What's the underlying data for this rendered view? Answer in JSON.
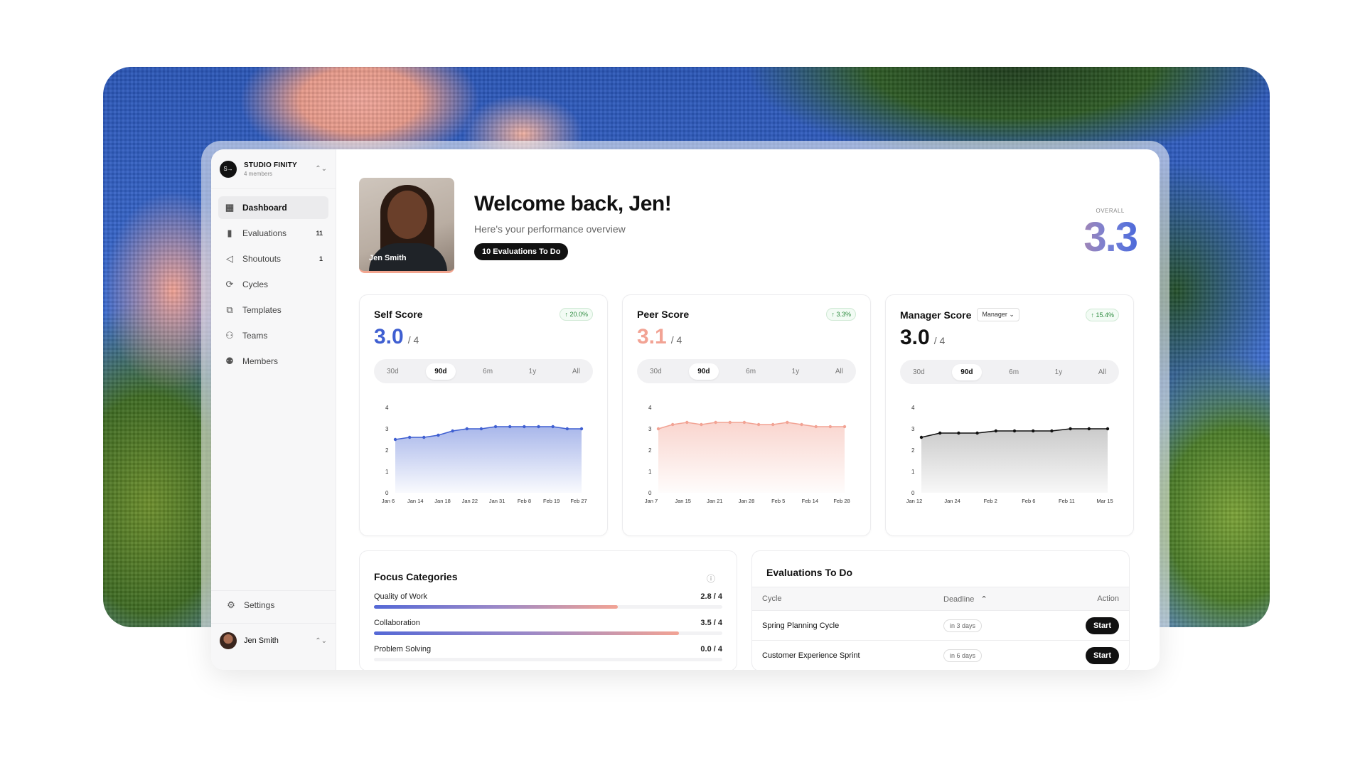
{
  "org": {
    "name": "STUDIO FINITY",
    "members": "4 members",
    "logo_text": "S→"
  },
  "nav": [
    {
      "icon": "▦",
      "label": "Dashboard",
      "badge": "",
      "active": true
    },
    {
      "icon": "▮",
      "label": "Evaluations",
      "badge": "11"
    },
    {
      "icon": "◁",
      "label": "Shoutouts",
      "badge": "1"
    },
    {
      "icon": "⟳",
      "label": "Cycles",
      "badge": ""
    },
    {
      "icon": "⧉",
      "label": "Templates",
      "badge": ""
    },
    {
      "icon": "⚇",
      "label": "Teams",
      "badge": ""
    },
    {
      "icon": "⚉",
      "label": "Members",
      "badge": ""
    }
  ],
  "settings_label": "Settings",
  "user_name": "Jen Smith",
  "hero": {
    "photo_name": "Jen Smith",
    "title": "Welcome back, Jen!",
    "subtitle": "Here's your performance overview",
    "todo_pill": "10 Evaluations To Do"
  },
  "overall": {
    "label": "OVERALL",
    "value": "3.3"
  },
  "range_options": [
    "30d",
    "90d",
    "6m",
    "1y",
    "All"
  ],
  "cards": [
    {
      "title": "Self Score",
      "delta": "↑ 20.0%",
      "score": "3.0",
      "of": "/ 4",
      "score_color": "#3f5fd1",
      "selected_range": "90d"
    },
    {
      "title": "Peer Score",
      "delta": "↑ 3.3%",
      "score": "3.1",
      "of": "/ 4",
      "score_color": "#f2a394",
      "selected_range": "90d"
    },
    {
      "title": "Manager Score",
      "delta": "↑ 15.4%",
      "score": "3.0",
      "of": "/ 4",
      "score_color": "#111111",
      "selected_range": "90d",
      "filter": "Manager"
    }
  ],
  "chart_data": [
    {
      "type": "area",
      "title": "Self Score",
      "ylim": [
        0,
        4
      ],
      "yticks": [
        "0",
        "1",
        "2",
        "3",
        "4"
      ],
      "x_labels": [
        "Jan 6",
        "Jan 14",
        "Jan 18",
        "Jan 22",
        "Jan 31",
        "Feb 8",
        "Feb 19",
        "Feb 27"
      ],
      "values": [
        2.5,
        2.6,
        2.6,
        2.7,
        2.9,
        3.0,
        3.0,
        3.1,
        3.1,
        3.1,
        3.1,
        3.1,
        3.0,
        3.0
      ],
      "color": "#3f5fd1"
    },
    {
      "type": "area",
      "title": "Peer Score",
      "ylim": [
        0,
        4
      ],
      "yticks": [
        "0",
        "1",
        "2",
        "3",
        "4"
      ],
      "x_labels": [
        "Jan 7",
        "Jan 15",
        "Jan 21",
        "Jan 28",
        "Feb 5",
        "Feb 14",
        "Feb 28"
      ],
      "values": [
        3.0,
        3.2,
        3.3,
        3.2,
        3.3,
        3.3,
        3.3,
        3.2,
        3.2,
        3.3,
        3.2,
        3.1,
        3.1,
        3.1
      ],
      "color": "#f2a394"
    },
    {
      "type": "area",
      "title": "Manager Score",
      "ylim": [
        0,
        4
      ],
      "yticks": [
        "0",
        "1",
        "2",
        "3",
        "4"
      ],
      "x_labels": [
        "Jan 12",
        "Jan 24",
        "Feb 2",
        "Feb 6",
        "Feb 11",
        "Mar 15"
      ],
      "values": [
        2.6,
        2.8,
        2.8,
        2.8,
        2.9,
        2.9,
        2.9,
        2.9,
        3.0,
        3.0,
        3.0
      ],
      "color": "#111111"
    }
  ],
  "focus": {
    "title": "Focus Categories",
    "items": [
      {
        "label": "Quality of Work",
        "score": "2.8 / 4",
        "value": 2.8
      },
      {
        "label": "Collaboration",
        "score": "3.5 / 4",
        "value": 3.5
      },
      {
        "label": "Problem Solving",
        "score": "0.0 / 4",
        "value": 0.0
      }
    ]
  },
  "evaluations": {
    "title": "Evaluations To Do",
    "col_cycle": "Cycle",
    "col_deadline": "Deadline",
    "col_action": "Action",
    "rows": [
      {
        "cycle": "Spring Planning Cycle",
        "deadline": "in 3 days",
        "action": "Start"
      },
      {
        "cycle": "Customer Experience Sprint",
        "deadline": "in 6 days",
        "action": "Start"
      }
    ]
  }
}
